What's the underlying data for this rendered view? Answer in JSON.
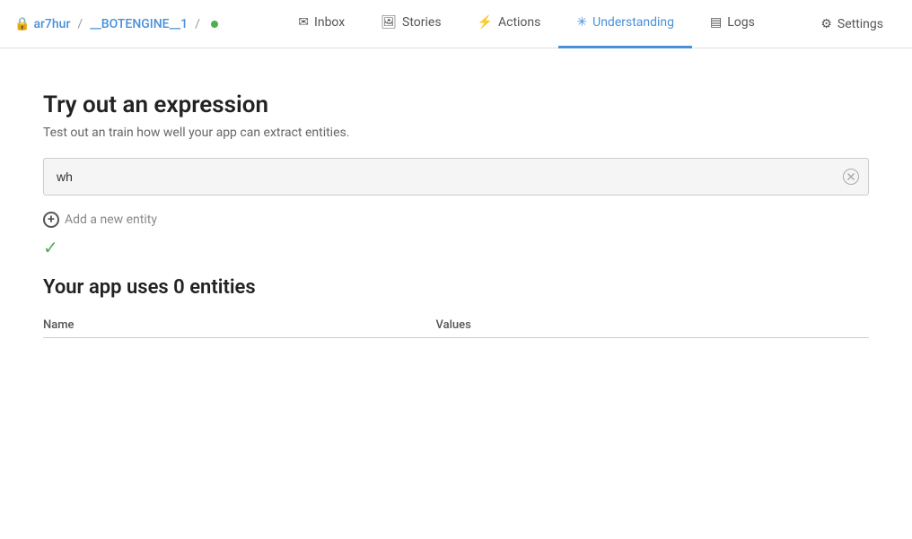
{
  "nav": {
    "brand": {
      "lock_icon": "🔒",
      "username": "ar7hur",
      "separator": "/",
      "bot_name": "__BOTENGINE__1",
      "separator2": "/",
      "status_color": "#4caf50"
    },
    "links": [
      {
        "id": "inbox",
        "label": "Inbox",
        "icon": "✉",
        "active": false
      },
      {
        "id": "stories",
        "label": "Stories",
        "icon": "🖼",
        "active": false
      },
      {
        "id": "actions",
        "label": "Actions",
        "icon": "⚡",
        "active": false
      },
      {
        "id": "understanding",
        "label": "Understanding",
        "icon": "✳",
        "active": true
      },
      {
        "id": "logs",
        "label": "Logs",
        "icon": "▤",
        "active": false
      }
    ],
    "settings_label": "Settings"
  },
  "page": {
    "title": "Try out an expression",
    "subtitle": "Test out an train how well your app can extract entities.",
    "input_value": "wh|",
    "input_placeholder": "",
    "add_entity_label": "Add a new entity",
    "check_mark": "✓",
    "entities_heading": "Your app uses 0 entities",
    "table": {
      "columns": [
        "Name",
        "Values"
      ],
      "rows": []
    }
  }
}
